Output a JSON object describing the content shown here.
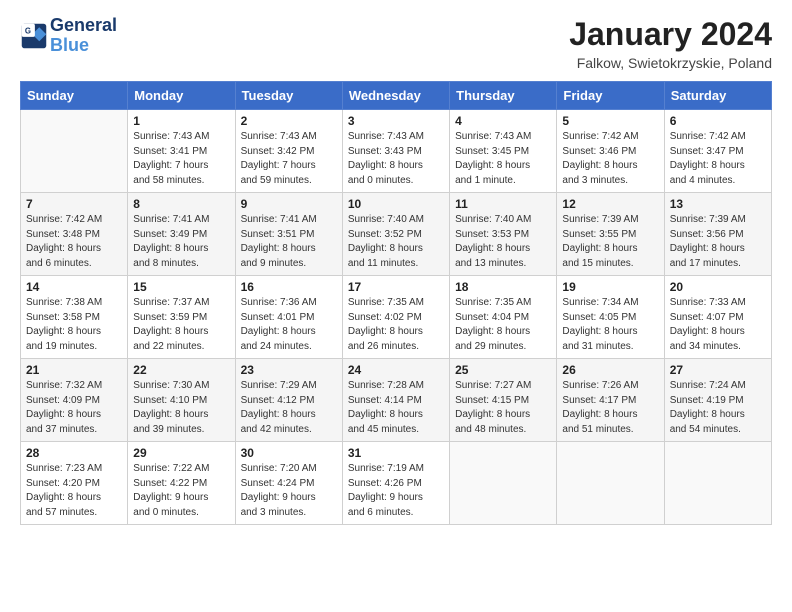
{
  "header": {
    "logo_line1": "General",
    "logo_line2": "Blue",
    "title": "January 2024",
    "subtitle": "Falkow, Swietokrzyskie, Poland"
  },
  "days_of_week": [
    "Sunday",
    "Monday",
    "Tuesday",
    "Wednesday",
    "Thursday",
    "Friday",
    "Saturday"
  ],
  "weeks": [
    [
      {
        "day": "",
        "info": ""
      },
      {
        "day": "1",
        "info": "Sunrise: 7:43 AM\nSunset: 3:41 PM\nDaylight: 7 hours\nand 58 minutes."
      },
      {
        "day": "2",
        "info": "Sunrise: 7:43 AM\nSunset: 3:42 PM\nDaylight: 7 hours\nand 59 minutes."
      },
      {
        "day": "3",
        "info": "Sunrise: 7:43 AM\nSunset: 3:43 PM\nDaylight: 8 hours\nand 0 minutes."
      },
      {
        "day": "4",
        "info": "Sunrise: 7:43 AM\nSunset: 3:45 PM\nDaylight: 8 hours\nand 1 minute."
      },
      {
        "day": "5",
        "info": "Sunrise: 7:42 AM\nSunset: 3:46 PM\nDaylight: 8 hours\nand 3 minutes."
      },
      {
        "day": "6",
        "info": "Sunrise: 7:42 AM\nSunset: 3:47 PM\nDaylight: 8 hours\nand 4 minutes."
      }
    ],
    [
      {
        "day": "7",
        "info": "Sunrise: 7:42 AM\nSunset: 3:48 PM\nDaylight: 8 hours\nand 6 minutes."
      },
      {
        "day": "8",
        "info": "Sunrise: 7:41 AM\nSunset: 3:49 PM\nDaylight: 8 hours\nand 8 minutes."
      },
      {
        "day": "9",
        "info": "Sunrise: 7:41 AM\nSunset: 3:51 PM\nDaylight: 8 hours\nand 9 minutes."
      },
      {
        "day": "10",
        "info": "Sunrise: 7:40 AM\nSunset: 3:52 PM\nDaylight: 8 hours\nand 11 minutes."
      },
      {
        "day": "11",
        "info": "Sunrise: 7:40 AM\nSunset: 3:53 PM\nDaylight: 8 hours\nand 13 minutes."
      },
      {
        "day": "12",
        "info": "Sunrise: 7:39 AM\nSunset: 3:55 PM\nDaylight: 8 hours\nand 15 minutes."
      },
      {
        "day": "13",
        "info": "Sunrise: 7:39 AM\nSunset: 3:56 PM\nDaylight: 8 hours\nand 17 minutes."
      }
    ],
    [
      {
        "day": "14",
        "info": "Sunrise: 7:38 AM\nSunset: 3:58 PM\nDaylight: 8 hours\nand 19 minutes."
      },
      {
        "day": "15",
        "info": "Sunrise: 7:37 AM\nSunset: 3:59 PM\nDaylight: 8 hours\nand 22 minutes."
      },
      {
        "day": "16",
        "info": "Sunrise: 7:36 AM\nSunset: 4:01 PM\nDaylight: 8 hours\nand 24 minutes."
      },
      {
        "day": "17",
        "info": "Sunrise: 7:35 AM\nSunset: 4:02 PM\nDaylight: 8 hours\nand 26 minutes."
      },
      {
        "day": "18",
        "info": "Sunrise: 7:35 AM\nSunset: 4:04 PM\nDaylight: 8 hours\nand 29 minutes."
      },
      {
        "day": "19",
        "info": "Sunrise: 7:34 AM\nSunset: 4:05 PM\nDaylight: 8 hours\nand 31 minutes."
      },
      {
        "day": "20",
        "info": "Sunrise: 7:33 AM\nSunset: 4:07 PM\nDaylight: 8 hours\nand 34 minutes."
      }
    ],
    [
      {
        "day": "21",
        "info": "Sunrise: 7:32 AM\nSunset: 4:09 PM\nDaylight: 8 hours\nand 37 minutes."
      },
      {
        "day": "22",
        "info": "Sunrise: 7:30 AM\nSunset: 4:10 PM\nDaylight: 8 hours\nand 39 minutes."
      },
      {
        "day": "23",
        "info": "Sunrise: 7:29 AM\nSunset: 4:12 PM\nDaylight: 8 hours\nand 42 minutes."
      },
      {
        "day": "24",
        "info": "Sunrise: 7:28 AM\nSunset: 4:14 PM\nDaylight: 8 hours\nand 45 minutes."
      },
      {
        "day": "25",
        "info": "Sunrise: 7:27 AM\nSunset: 4:15 PM\nDaylight: 8 hours\nand 48 minutes."
      },
      {
        "day": "26",
        "info": "Sunrise: 7:26 AM\nSunset: 4:17 PM\nDaylight: 8 hours\nand 51 minutes."
      },
      {
        "day": "27",
        "info": "Sunrise: 7:24 AM\nSunset: 4:19 PM\nDaylight: 8 hours\nand 54 minutes."
      }
    ],
    [
      {
        "day": "28",
        "info": "Sunrise: 7:23 AM\nSunset: 4:20 PM\nDaylight: 8 hours\nand 57 minutes."
      },
      {
        "day": "29",
        "info": "Sunrise: 7:22 AM\nSunset: 4:22 PM\nDaylight: 9 hours\nand 0 minutes."
      },
      {
        "day": "30",
        "info": "Sunrise: 7:20 AM\nSunset: 4:24 PM\nDaylight: 9 hours\nand 3 minutes."
      },
      {
        "day": "31",
        "info": "Sunrise: 7:19 AM\nSunset: 4:26 PM\nDaylight: 9 hours\nand 6 minutes."
      },
      {
        "day": "",
        "info": ""
      },
      {
        "day": "",
        "info": ""
      },
      {
        "day": "",
        "info": ""
      }
    ]
  ]
}
